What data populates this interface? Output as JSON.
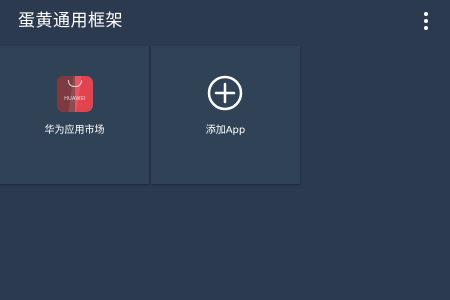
{
  "app_bar": {
    "title": "蛋黄通用框架",
    "menu_icon": "more-vertical-icon"
  },
  "tiles": [
    {
      "label": "华为应用市场",
      "icon": "huawei-appgallery-icon",
      "icon_text": "HUAWEI",
      "icon_color": "#e2434f"
    },
    {
      "label": "添加App",
      "icon": "add-circle-icon"
    }
  ],
  "colors": {
    "background": "#2b3a4f",
    "tile_background": "#2f4256",
    "text": "#ffffff"
  }
}
